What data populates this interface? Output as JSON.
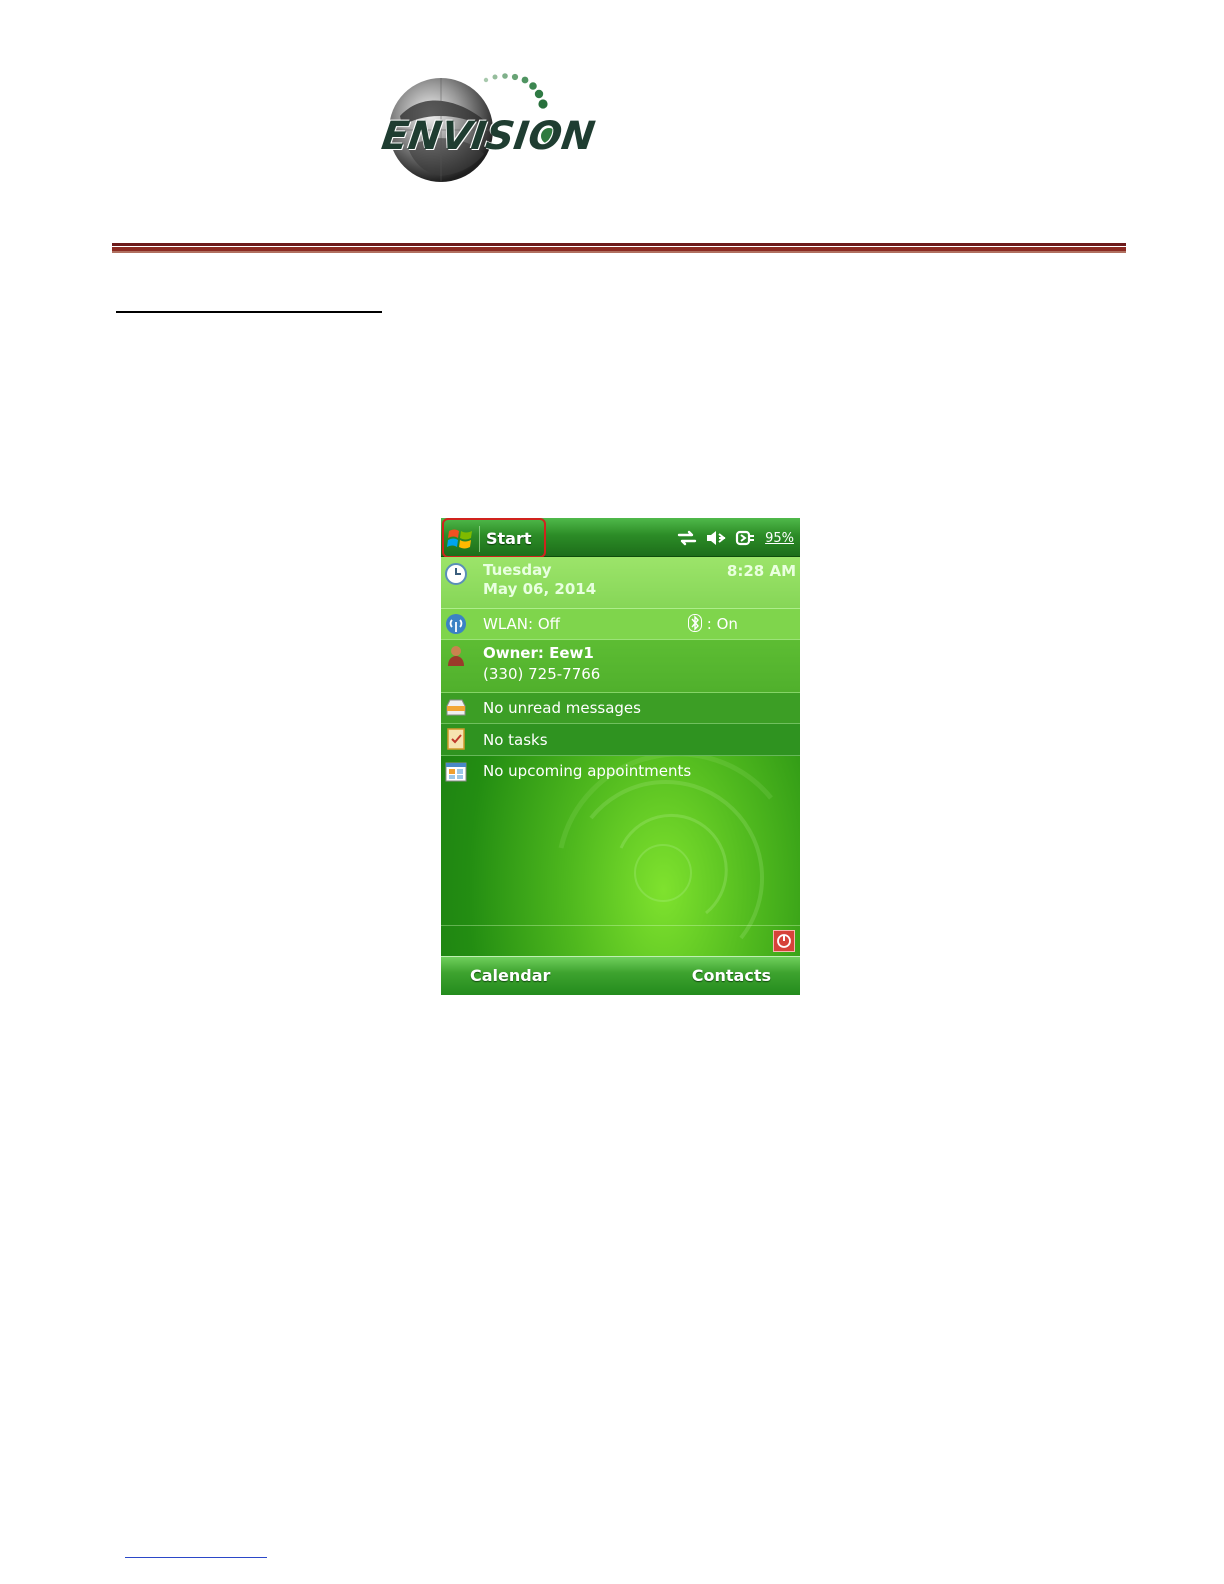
{
  "logo": {
    "wordmark": "ENVISION",
    "brand_color": "#1f3d31",
    "dot_color": "#2f7a3f"
  },
  "header_rule_color": "#8b2a22",
  "device_screen": {
    "titlebar": {
      "start_label": "Start",
      "battery": "95%",
      "status_icons": [
        "sync-arrows-icon",
        "speaker-muted-icon",
        "power-plug-icon"
      ]
    },
    "today_items": {
      "date": {
        "day": "Tuesday",
        "date": "May 06, 2014",
        "time": "8:28 AM"
      },
      "wlan": {
        "label": "WLAN: Off",
        "bluetooth": ": On"
      },
      "owner": {
        "name": "Owner: Eew1",
        "phone": "(330) 725-7766"
      },
      "messages": "No unread messages",
      "tasks": "No tasks",
      "appointments": "No upcoming appointments"
    },
    "softkeys": {
      "left": "Calendar",
      "right": "Contacts"
    },
    "colors": {
      "highlight": "#d0231d",
      "screen_green": "#2c8c27"
    }
  }
}
